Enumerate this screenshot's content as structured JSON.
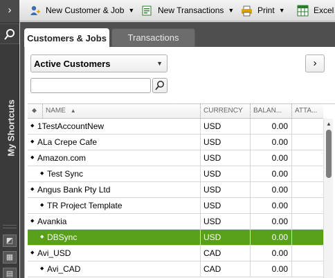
{
  "toolbar": {
    "new_customer_label": "New Customer & Job",
    "new_transactions_label": "New Transactions",
    "print_label": "Print",
    "excel_label": "Excel"
  },
  "shortcuts": {
    "label": "My Shortcuts"
  },
  "tabs": [
    {
      "label": "Customers & Jobs",
      "active": true
    },
    {
      "label": "Transactions",
      "active": false
    }
  ],
  "filter": {
    "selected": "Active Customers"
  },
  "search": {
    "value": ""
  },
  "grid": {
    "columns": [
      "NAME",
      "CURRENCY",
      "BALAN...",
      "ATTA..."
    ],
    "rows": [
      {
        "name": "1TestAccountNew",
        "currency": "USD",
        "balance": "0.00",
        "indent": 0,
        "selected": false
      },
      {
        "name": "ALa Crepe Cafe",
        "currency": "USD",
        "balance": "0.00",
        "indent": 0,
        "selected": false
      },
      {
        "name": "Amazon.com",
        "currency": "USD",
        "balance": "0.00",
        "indent": 0,
        "selected": false
      },
      {
        "name": "Test Sync",
        "currency": "USD",
        "balance": "0.00",
        "indent": 1,
        "selected": false
      },
      {
        "name": "Angus Bank Pty Ltd",
        "currency": "USD",
        "balance": "0.00",
        "indent": 0,
        "selected": false
      },
      {
        "name": "TR Project Template",
        "currency": "USD",
        "balance": "0.00",
        "indent": 1,
        "selected": false
      },
      {
        "name": "Avankia",
        "currency": "USD",
        "balance": "0.00",
        "indent": 0,
        "selected": false
      },
      {
        "name": "DBSync",
        "currency": "USD",
        "balance": "0.00",
        "indent": 1,
        "selected": true
      },
      {
        "name": "Avi_USD",
        "currency": "CAD",
        "balance": "0.00",
        "indent": 0,
        "selected": false
      },
      {
        "name": "Avi_CAD",
        "currency": "CAD",
        "balance": "0.00",
        "indent": 1,
        "selected": false
      }
    ]
  },
  "colors": {
    "selection": "#59a01a",
    "sidebar": "#3a3a3a",
    "panel": "#4f4f4f"
  }
}
